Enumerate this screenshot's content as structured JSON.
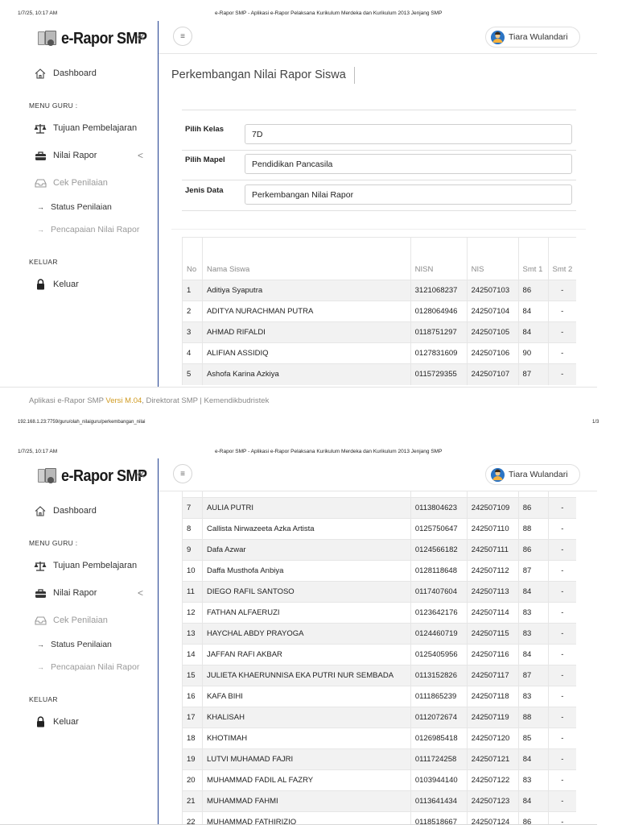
{
  "print": {
    "datetime": "1/7/25, 10:17 AM",
    "doc_title": "e-Rapor SMP - Aplikasi e-Rapor Pelaksana Kurikulum Merdeka dan Kurikulum 2013 Jenjang SMP",
    "url": "192.168.1.23:7759/guru/olah_nilaiguru/perkembangan_nilai",
    "page_num": "1/3"
  },
  "brand": {
    "name": "e-Rapor SMP",
    "collapse_icon": "«"
  },
  "topbar": {
    "menu_icon": "≡",
    "user_name": "Tiara Wulandari"
  },
  "sidebar": {
    "dashboard": "Dashboard",
    "section_guru": "MENU GURU :",
    "tujuan": "Tujuan Pembelajaran",
    "nilai_rapor": "Nilai Rapor",
    "nilai_chev": "<",
    "cek_penilaian": "Cek Penilaian",
    "status_penilaian": "Status Penilaian",
    "pencapaian": "Pencapaian Nilai Rapor",
    "section_keluar": "KELUAR",
    "keluar": "Keluar",
    "arrow": "→"
  },
  "page_title": "Perkembangan Nilai Rapor Siswa",
  "form": {
    "kelas_label": "Pilih Kelas",
    "kelas_value": "7D",
    "mapel_label": "Pilih Mapel",
    "mapel_value": "Pendidikan Pancasila",
    "jenis_label": "Jenis Data",
    "jenis_value": "Perkembangan Nilai Rapor"
  },
  "table": {
    "headers": {
      "no": "No",
      "nama": "Nama Siswa",
      "nisn": "NISN",
      "nis": "NIS",
      "smt1": "Smt 1",
      "smt2": "Smt 2"
    },
    "rows": [
      {
        "no": "1",
        "nama": "Aditiya Syaputra",
        "nisn": "3121068237",
        "nis": "242507103",
        "smt1": "86",
        "smt2": "-"
      },
      {
        "no": "2",
        "nama": "ADITYA NURACHMAN PUTRA",
        "nisn": "0128064946",
        "nis": "242507104",
        "smt1": "84",
        "smt2": "-"
      },
      {
        "no": "3",
        "nama": "AHMAD RIFALDI",
        "nisn": "0118751297",
        "nis": "242507105",
        "smt1": "84",
        "smt2": "-"
      },
      {
        "no": "4",
        "nama": "ALIFIAN ASSIDIQ",
        "nisn": "0127831609",
        "nis": "242507106",
        "smt1": "90",
        "smt2": "-"
      },
      {
        "no": "5",
        "nama": "Ashofa Karina Azkiya",
        "nisn": "0115729355",
        "nis": "242507107",
        "smt1": "87",
        "smt2": "-"
      },
      {
        "no": "7",
        "nama": "AULIA PUTRI",
        "nisn": "0113804623",
        "nis": "242507109",
        "smt1": "86",
        "smt2": "-"
      },
      {
        "no": "8",
        "nama": "Callista Nirwazeeta Azka Artista",
        "nisn": "0125750647",
        "nis": "242507110",
        "smt1": "88",
        "smt2": "-"
      },
      {
        "no": "9",
        "nama": "Dafa Azwar",
        "nisn": "0124566182",
        "nis": "242507111",
        "smt1": "86",
        "smt2": "-"
      },
      {
        "no": "10",
        "nama": "Daffa Musthofa Anbiya",
        "nisn": "0128118648",
        "nis": "242507112",
        "smt1": "87",
        "smt2": "-"
      },
      {
        "no": "11",
        "nama": "DIEGO RAFIL SANTOSO",
        "nisn": "0117407604",
        "nis": "242507113",
        "smt1": "84",
        "smt2": "-"
      },
      {
        "no": "12",
        "nama": "FATHAN ALFAERUZI",
        "nisn": "0123642176",
        "nis": "242507114",
        "smt1": "83",
        "smt2": "-"
      },
      {
        "no": "13",
        "nama": "HAYCHAL ABDY PRAYOGA",
        "nisn": "0124460719",
        "nis": "242507115",
        "smt1": "83",
        "smt2": "-"
      },
      {
        "no": "14",
        "nama": "JAFFAN RAFI AKBAR",
        "nisn": "0125405956",
        "nis": "242507116",
        "smt1": "84",
        "smt2": "-"
      },
      {
        "no": "15",
        "nama": "JULIETA KHAERUNNISA EKA PUTRI NUR SEMBADA",
        "nisn": "0113152826",
        "nis": "242507117",
        "smt1": "87",
        "smt2": "-"
      },
      {
        "no": "16",
        "nama": "KAFA BIHI",
        "nisn": "0111865239",
        "nis": "242507118",
        "smt1": "83",
        "smt2": "-"
      },
      {
        "no": "17",
        "nama": "KHALISAH",
        "nisn": "0112072674",
        "nis": "242507119",
        "smt1": "88",
        "smt2": "-"
      },
      {
        "no": "18",
        "nama": "KHOTIMAH",
        "nisn": "0126985418",
        "nis": "242507120",
        "smt1": "85",
        "smt2": "-"
      },
      {
        "no": "19",
        "nama": "LUTVI MUHAMAD FAJRI",
        "nisn": "0111724258",
        "nis": "242507121",
        "smt1": "84",
        "smt2": "-"
      },
      {
        "no": "20",
        "nama": "MUHAMMAD FADIL AL FAZRY",
        "nisn": "0103944140",
        "nis": "242507122",
        "smt1": "83",
        "smt2": "-"
      },
      {
        "no": "21",
        "nama": "MUHAMMAD FAHMI",
        "nisn": "0113641434",
        "nis": "242507123",
        "smt1": "84",
        "smt2": "-"
      },
      {
        "no": "22",
        "nama": "MUHAMMAD FATHIRIZIQ",
        "nisn": "0118518667",
        "nis": "242507124",
        "smt1": "86",
        "smt2": "-"
      }
    ]
  },
  "footer": {
    "app": "Aplikasi e-Rapor SMP ",
    "version": "Versi M.04",
    "org": ", Direktorat SMP | Kemendikbudristek"
  }
}
